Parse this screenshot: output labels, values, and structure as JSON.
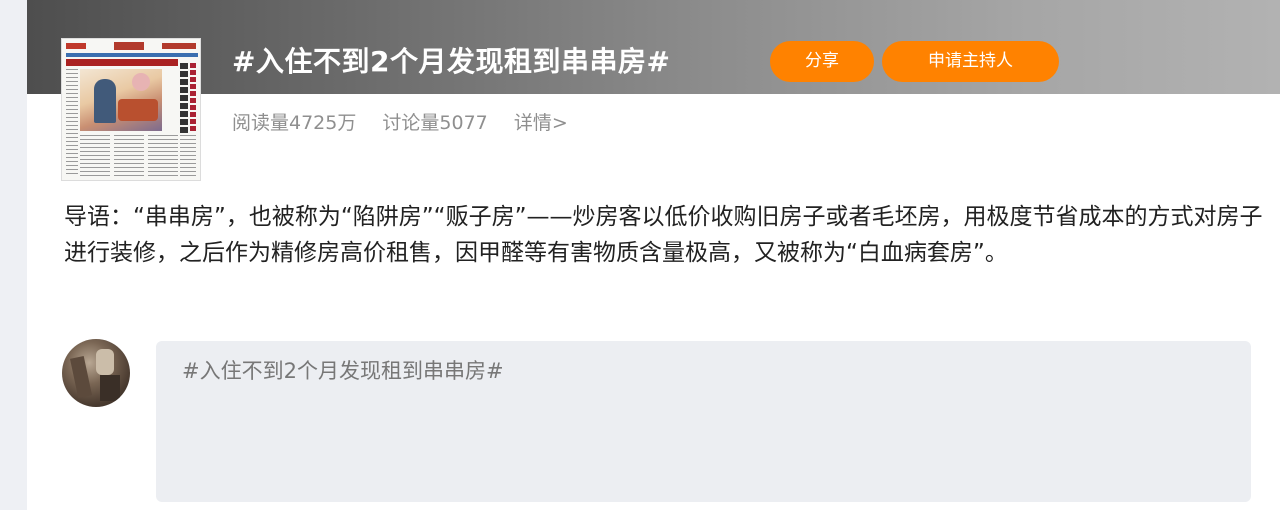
{
  "topic": {
    "title": "#入住不到2个月发现租到串串房#",
    "share_label": "分享",
    "host_label": "申请主持人",
    "reads": "阅读量4725万",
    "discussions": "讨论量5077",
    "details_label": "详情>"
  },
  "intro_text": "导语：“串串房”，也被称为“陷阱房”“贩子房”——炒房客以低价收购旧房子或者毛坯房，用极度节省成本的方式对房子进行装修，之后作为精修房高价租售，因甲醛等有害物质含量极高，又被称为“白血病套房”。",
  "composer": {
    "content": "#入住不到2个月发现租到串串房#"
  },
  "colors": {
    "accent": "#ff8200",
    "banner_dark": "#4e4e4e",
    "banner_light": "#b2b2b2",
    "composer_bg": "#eceef2"
  },
  "icons": [
    "newspaper-cover-image",
    "user-avatar"
  ]
}
